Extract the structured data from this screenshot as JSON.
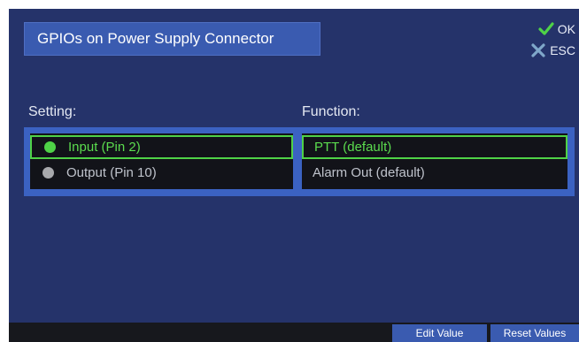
{
  "title": "GPIOs on Power Supply Connector",
  "actions": {
    "ok_label": "OK",
    "esc_label": "ESC"
  },
  "columns": {
    "setting": "Setting:",
    "function": "Function:"
  },
  "rows": [
    {
      "setting": "Input (Pin 2)",
      "function": "PTT (default)",
      "selected": true,
      "indicator": "green-dot"
    },
    {
      "setting": "Output (Pin 10)",
      "function": "Alarm Out (default)",
      "selected": false,
      "indicator": "gray-dot"
    }
  ],
  "softkeys": {
    "edit_value": "Edit Value",
    "reset_values": "Reset Values"
  },
  "colors": {
    "background": "#25336a",
    "accent": "#3a5bb0",
    "selected": "#4fd247",
    "ok_icon": "#4fd247",
    "esc_icon": "#7fa7c9"
  }
}
